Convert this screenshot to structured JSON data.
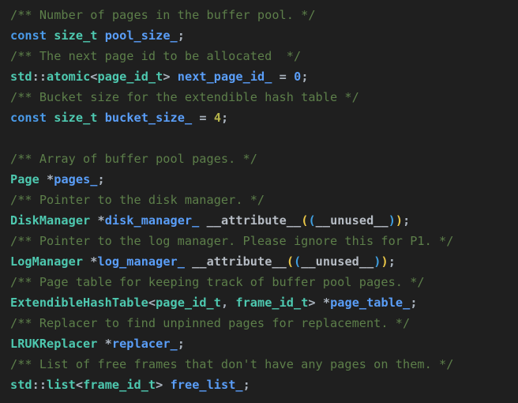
{
  "editor": {
    "language": "cpp",
    "background_color": "#1f1f1f",
    "colors": {
      "comment": "#5d7f4a",
      "keyword": "#4a9ae8",
      "type": "#4ec9b0",
      "identifier": "#5a9ef8",
      "punctuation": "#a9b2bd",
      "bracket_level_1": "#e8c547",
      "bracket_level_2": "#3f9fe0",
      "number": "#5a9ef8",
      "number_alt": "#b5b34a"
    },
    "lines": [
      {
        "index": 1,
        "text": "/** Number of pages in the buffer pool. */",
        "tokens": [
          {
            "t": "/** Number of pages in the buffer pool. */",
            "k": "comment"
          }
        ]
      },
      {
        "index": 2,
        "text": "const size_t pool_size_;",
        "tokens": [
          {
            "t": "const",
            "k": "keyword"
          },
          {
            "t": " ",
            "k": "plain"
          },
          {
            "t": "size_t",
            "k": "type"
          },
          {
            "t": " ",
            "k": "plain"
          },
          {
            "t": "pool_size_",
            "k": "ident"
          },
          {
            "t": ";",
            "k": "punct"
          }
        ]
      },
      {
        "index": 3,
        "text": "/** The next page id to be allocated  */",
        "tokens": [
          {
            "t": "/** The next page id to be allocated  */",
            "k": "comment"
          }
        ]
      },
      {
        "index": 4,
        "text": "std::atomic<page_id_t> next_page_id_ = 0;",
        "tokens": [
          {
            "t": "std",
            "k": "type"
          },
          {
            "t": "::",
            "k": "punct"
          },
          {
            "t": "atomic",
            "k": "type"
          },
          {
            "t": "<",
            "k": "punct"
          },
          {
            "t": "page_id_t",
            "k": "type"
          },
          {
            "t": ">",
            "k": "punct"
          },
          {
            "t": " ",
            "k": "plain"
          },
          {
            "t": "next_page_id_",
            "k": "ident"
          },
          {
            "t": " ",
            "k": "plain"
          },
          {
            "t": "=",
            "k": "punct"
          },
          {
            "t": " ",
            "k": "plain"
          },
          {
            "t": "0",
            "k": "number"
          },
          {
            "t": ";",
            "k": "punct"
          }
        ]
      },
      {
        "index": 5,
        "text": "/** Bucket size for the extendible hash table */",
        "tokens": [
          {
            "t": "/** Bucket size for the extendible hash table */",
            "k": "comment"
          }
        ]
      },
      {
        "index": 6,
        "text": "const size_t bucket_size_ = 4;",
        "tokens": [
          {
            "t": "const",
            "k": "keyword"
          },
          {
            "t": " ",
            "k": "plain"
          },
          {
            "t": "size_t",
            "k": "type"
          },
          {
            "t": " ",
            "k": "plain"
          },
          {
            "t": "bucket_size_",
            "k": "ident"
          },
          {
            "t": " ",
            "k": "plain"
          },
          {
            "t": "=",
            "k": "punct"
          },
          {
            "t": " ",
            "k": "plain"
          },
          {
            "t": "4",
            "k": "number-alt"
          },
          {
            "t": ";",
            "k": "punct"
          }
        ]
      },
      {
        "index": 7,
        "text": "",
        "tokens": []
      },
      {
        "index": 8,
        "text": "/** Array of buffer pool pages. */",
        "tokens": [
          {
            "t": "/** Array of buffer pool pages. */",
            "k": "comment"
          }
        ]
      },
      {
        "index": 9,
        "text": "Page *pages_;",
        "tokens": [
          {
            "t": "Page",
            "k": "type"
          },
          {
            "t": " ",
            "k": "plain"
          },
          {
            "t": "*",
            "k": "punct"
          },
          {
            "t": "pages_",
            "k": "ident"
          },
          {
            "t": ";",
            "k": "punct"
          }
        ]
      },
      {
        "index": 10,
        "text": "/** Pointer to the disk manager. */",
        "tokens": [
          {
            "t": "/** Pointer to the disk manager. */",
            "k": "comment"
          }
        ]
      },
      {
        "index": 11,
        "text": "DiskManager *disk_manager_ __attribute__((__unused__));",
        "tokens": [
          {
            "t": "DiskManager",
            "k": "type"
          },
          {
            "t": " ",
            "k": "plain"
          },
          {
            "t": "*",
            "k": "punct"
          },
          {
            "t": "disk_manager_",
            "k": "ident"
          },
          {
            "t": " ",
            "k": "plain"
          },
          {
            "t": "__attribute__",
            "k": "macro"
          },
          {
            "t": "(",
            "k": "bracket1"
          },
          {
            "t": "(",
            "k": "bracket2"
          },
          {
            "t": "__unused__",
            "k": "macro"
          },
          {
            "t": ")",
            "k": "bracket2"
          },
          {
            "t": ")",
            "k": "bracket1"
          },
          {
            "t": ";",
            "k": "punct"
          }
        ]
      },
      {
        "index": 12,
        "text": "/** Pointer to the log manager. Please ignore this for P1. */",
        "tokens": [
          {
            "t": "/** Pointer to the log manager. Please ignore this for P1. */",
            "k": "comment"
          }
        ]
      },
      {
        "index": 13,
        "text": "LogManager *log_manager_ __attribute__((__unused__));",
        "tokens": [
          {
            "t": "LogManager",
            "k": "type"
          },
          {
            "t": " ",
            "k": "plain"
          },
          {
            "t": "*",
            "k": "punct"
          },
          {
            "t": "log_manager_",
            "k": "ident"
          },
          {
            "t": " ",
            "k": "plain"
          },
          {
            "t": "__attribute__",
            "k": "macro"
          },
          {
            "t": "(",
            "k": "bracket1"
          },
          {
            "t": "(",
            "k": "bracket2"
          },
          {
            "t": "__unused__",
            "k": "macro"
          },
          {
            "t": ")",
            "k": "bracket2"
          },
          {
            "t": ")",
            "k": "bracket1"
          },
          {
            "t": ";",
            "k": "punct"
          }
        ]
      },
      {
        "index": 14,
        "text": "/** Page table for keeping track of buffer pool pages. */",
        "tokens": [
          {
            "t": "/** Page table for keeping track of buffer pool pages. */",
            "k": "comment"
          }
        ]
      },
      {
        "index": 15,
        "text": "ExtendibleHashTable<page_id_t, frame_id_t> *page_table_;",
        "tokens": [
          {
            "t": "ExtendibleHashTable",
            "k": "type"
          },
          {
            "t": "<",
            "k": "punct"
          },
          {
            "t": "page_id_t",
            "k": "type"
          },
          {
            "t": ",",
            "k": "punct"
          },
          {
            "t": " ",
            "k": "plain"
          },
          {
            "t": "frame_id_t",
            "k": "type"
          },
          {
            "t": ">",
            "k": "punct"
          },
          {
            "t": " ",
            "k": "plain"
          },
          {
            "t": "*",
            "k": "punct"
          },
          {
            "t": "page_table_",
            "k": "ident"
          },
          {
            "t": ";",
            "k": "punct"
          }
        ]
      },
      {
        "index": 16,
        "text": "/** Replacer to find unpinned pages for replacement. */",
        "tokens": [
          {
            "t": "/** Replacer to find unpinned pages for replacement. */",
            "k": "comment"
          }
        ]
      },
      {
        "index": 17,
        "text": "LRUKReplacer *replacer_;",
        "tokens": [
          {
            "t": "LRUKReplacer",
            "k": "type"
          },
          {
            "t": " ",
            "k": "plain"
          },
          {
            "t": "*",
            "k": "punct"
          },
          {
            "t": "replacer_",
            "k": "ident"
          },
          {
            "t": ";",
            "k": "punct"
          }
        ]
      },
      {
        "index": 18,
        "text": "/** List of free frames that don't have any pages on them. */",
        "tokens": [
          {
            "t": "/** List of free frames that don't have any pages on them. */",
            "k": "comment"
          }
        ]
      },
      {
        "index": 19,
        "text": "std::list<frame_id_t> free_list_;",
        "tokens": [
          {
            "t": "std",
            "k": "type"
          },
          {
            "t": "::",
            "k": "punct"
          },
          {
            "t": "list",
            "k": "type"
          },
          {
            "t": "<",
            "k": "punct"
          },
          {
            "t": "frame_id_t",
            "k": "type"
          },
          {
            "t": ">",
            "k": "punct"
          },
          {
            "t": " ",
            "k": "plain"
          },
          {
            "t": "free_list_",
            "k": "ident"
          },
          {
            "t": ";",
            "k": "punct"
          }
        ]
      }
    ]
  }
}
